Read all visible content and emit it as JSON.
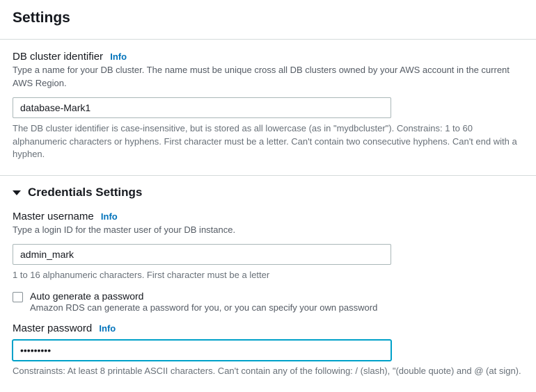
{
  "header": {
    "title": "Settings"
  },
  "clusterId": {
    "label": "DB cluster identifier",
    "info": "Info",
    "description": "Type a name for your DB cluster. The name must be unique cross all DB clusters owned by your AWS account in the current AWS Region.",
    "value": "database-Mark1",
    "hint": "The DB cluster identifier is case-insensitive, but is stored as all lowercase (as in \"mydbcluster\"). Constrains: 1 to 60 alphanumeric characters or hyphens. First character must be a letter. Can't contain two consecutive hyphens. Can't end with a hyphen."
  },
  "credentials": {
    "sectionTitle": "Credentials Settings",
    "username": {
      "label": "Master username",
      "info": "Info",
      "description": "Type a login ID for the master user of your DB instance.",
      "value": "admin_mark",
      "hint": "1 to 16 alphanumeric characters. First character must be a letter"
    },
    "autogen": {
      "label": "Auto generate a password",
      "description": "Amazon RDS can generate a password for you, or you can specify your own password"
    },
    "password": {
      "label": "Master password",
      "info": "Info",
      "value": "•••••••••",
      "hint": "Constrainsts: At least 8 printable ASCII characters. Can't contain any of the following: / (slash), \"(double quote) and @ (at sign)."
    }
  }
}
